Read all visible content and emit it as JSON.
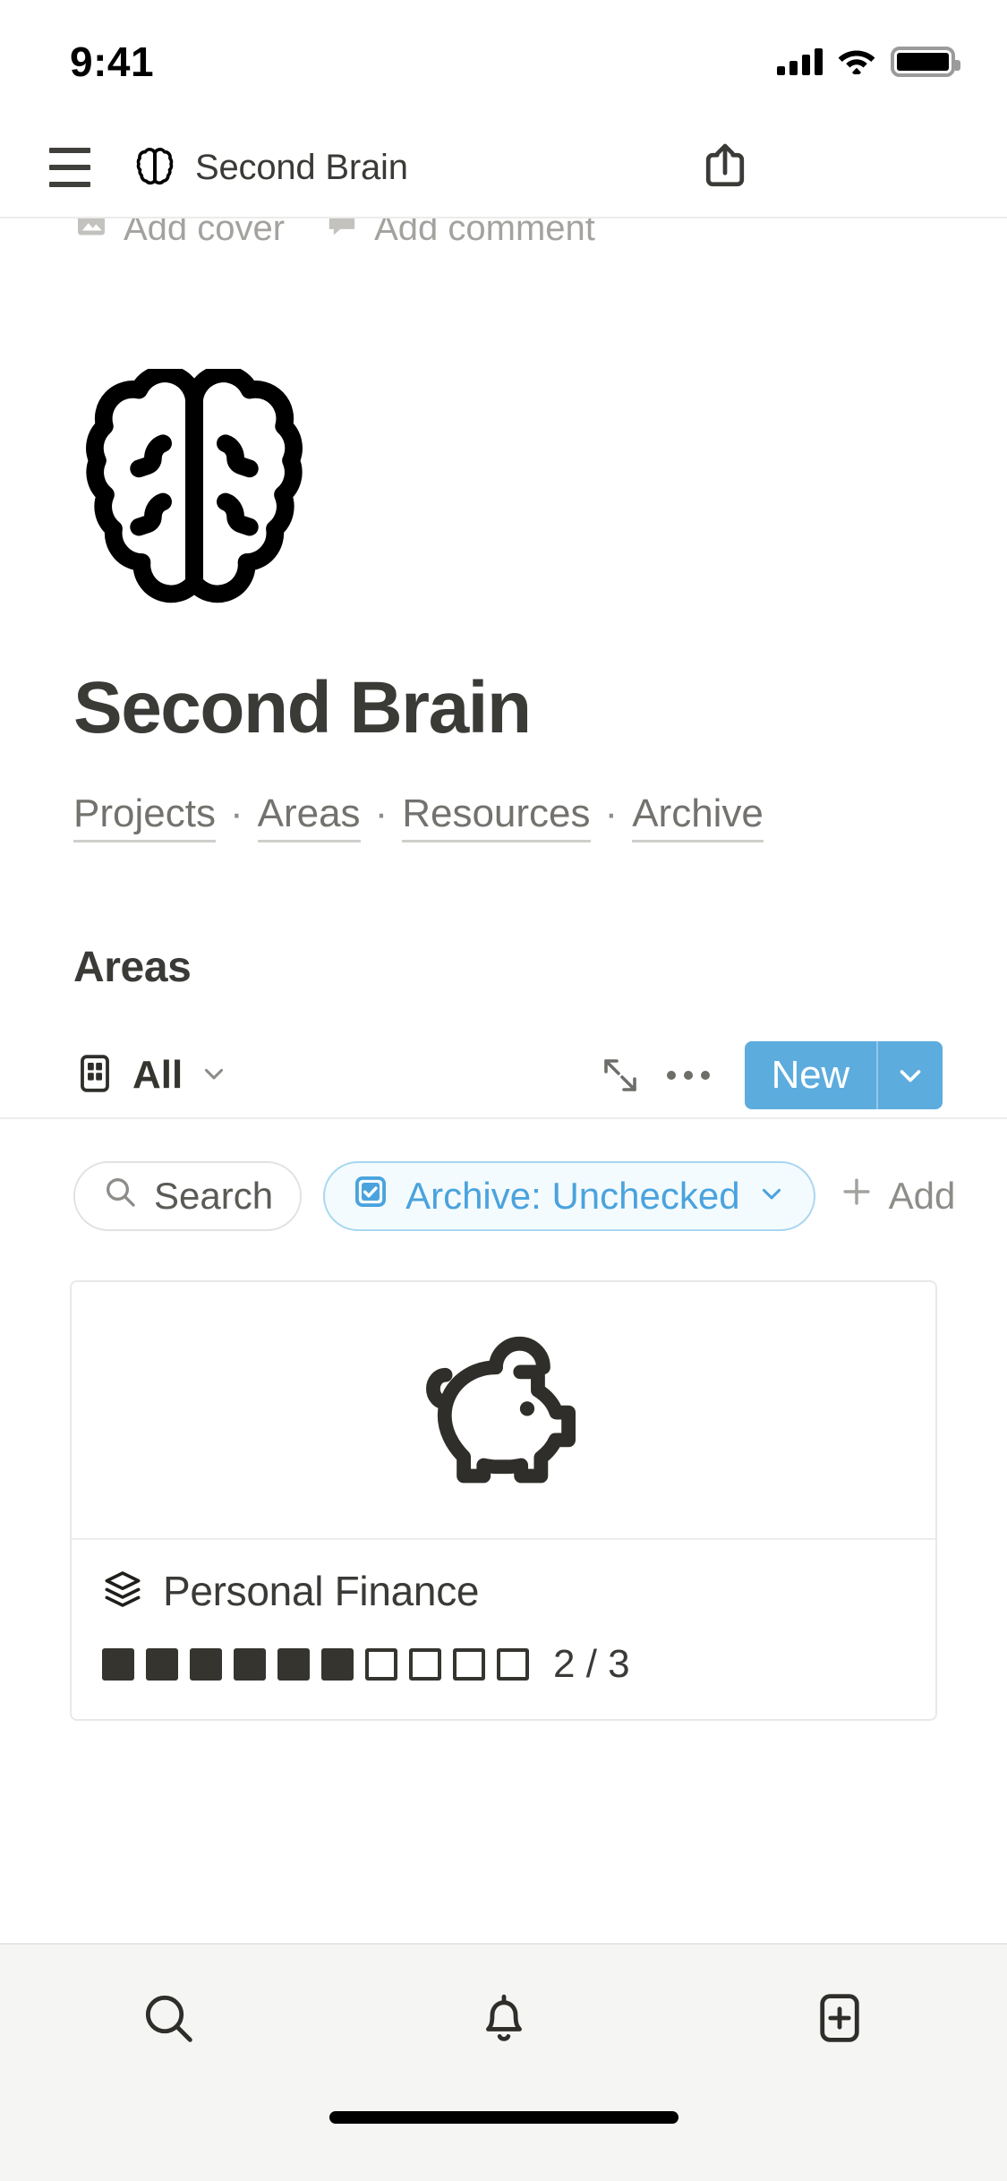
{
  "status_bar": {
    "time": "9:41",
    "icons": [
      "cellular-bars-icon",
      "wifi-icon",
      "battery-icon"
    ]
  },
  "nav_bar": {
    "menu_icon": "hamburger-menu-icon",
    "page_icon": "brain-icon",
    "title": "Second Brain",
    "share_icon": "share-icon"
  },
  "page_meta": {
    "add_cover_label": "Add cover",
    "add_cover_icon": "image-icon",
    "add_comment_label": "Add comment",
    "add_comment_icon": "comment-icon"
  },
  "page": {
    "icon": "brain-icon",
    "title": "Second Brain",
    "breadcrumb": [
      {
        "label": "Projects"
      },
      {
        "label": "Areas"
      },
      {
        "label": "Resources"
      },
      {
        "label": "Archive"
      }
    ],
    "breadcrumb_separator": "·"
  },
  "database": {
    "heading": "Areas",
    "toolbar": {
      "view_icon": "gallery-view-icon",
      "view_name": "All",
      "view_caret": "chevron-down-icon",
      "expand_icon": "expand-arrows-icon",
      "more_icon": "more-options-icon",
      "new_label": "New",
      "new_caret": "chevron-down-icon"
    },
    "filters": {
      "search_label": "Search",
      "search_icon": "search-icon",
      "active_filter_label": "Archive: Unchecked",
      "active_filter_icon": "checkbox-checked-icon",
      "active_filter_caret": "chevron-down-icon",
      "add_filter_label": "Add",
      "add_filter_icon": "plus-icon"
    },
    "cards": [
      {
        "cover_icon": "piggy-bank-icon",
        "title_icon": "layers-icon",
        "title": "Personal Finance",
        "progress_filled": 6,
        "progress_total": 10,
        "progress_label": "2 / 3"
      }
    ]
  },
  "tab_bar": {
    "tabs": [
      {
        "icon": "search-icon",
        "name": "search"
      },
      {
        "icon": "bell-icon",
        "name": "notifications"
      },
      {
        "icon": "new-page-icon",
        "name": "new-page"
      }
    ]
  },
  "colors": {
    "accent_blue": "#5cacdd",
    "filter_blue": "#4aa3dd",
    "filter_blue_bg": "#f4fbff",
    "text_dark": "#3a3a37",
    "text_muted": "#73726e",
    "text_placeholder": "#a3a29e",
    "border": "#e9e8e6",
    "tabbar_bg": "#f5f5f4"
  }
}
